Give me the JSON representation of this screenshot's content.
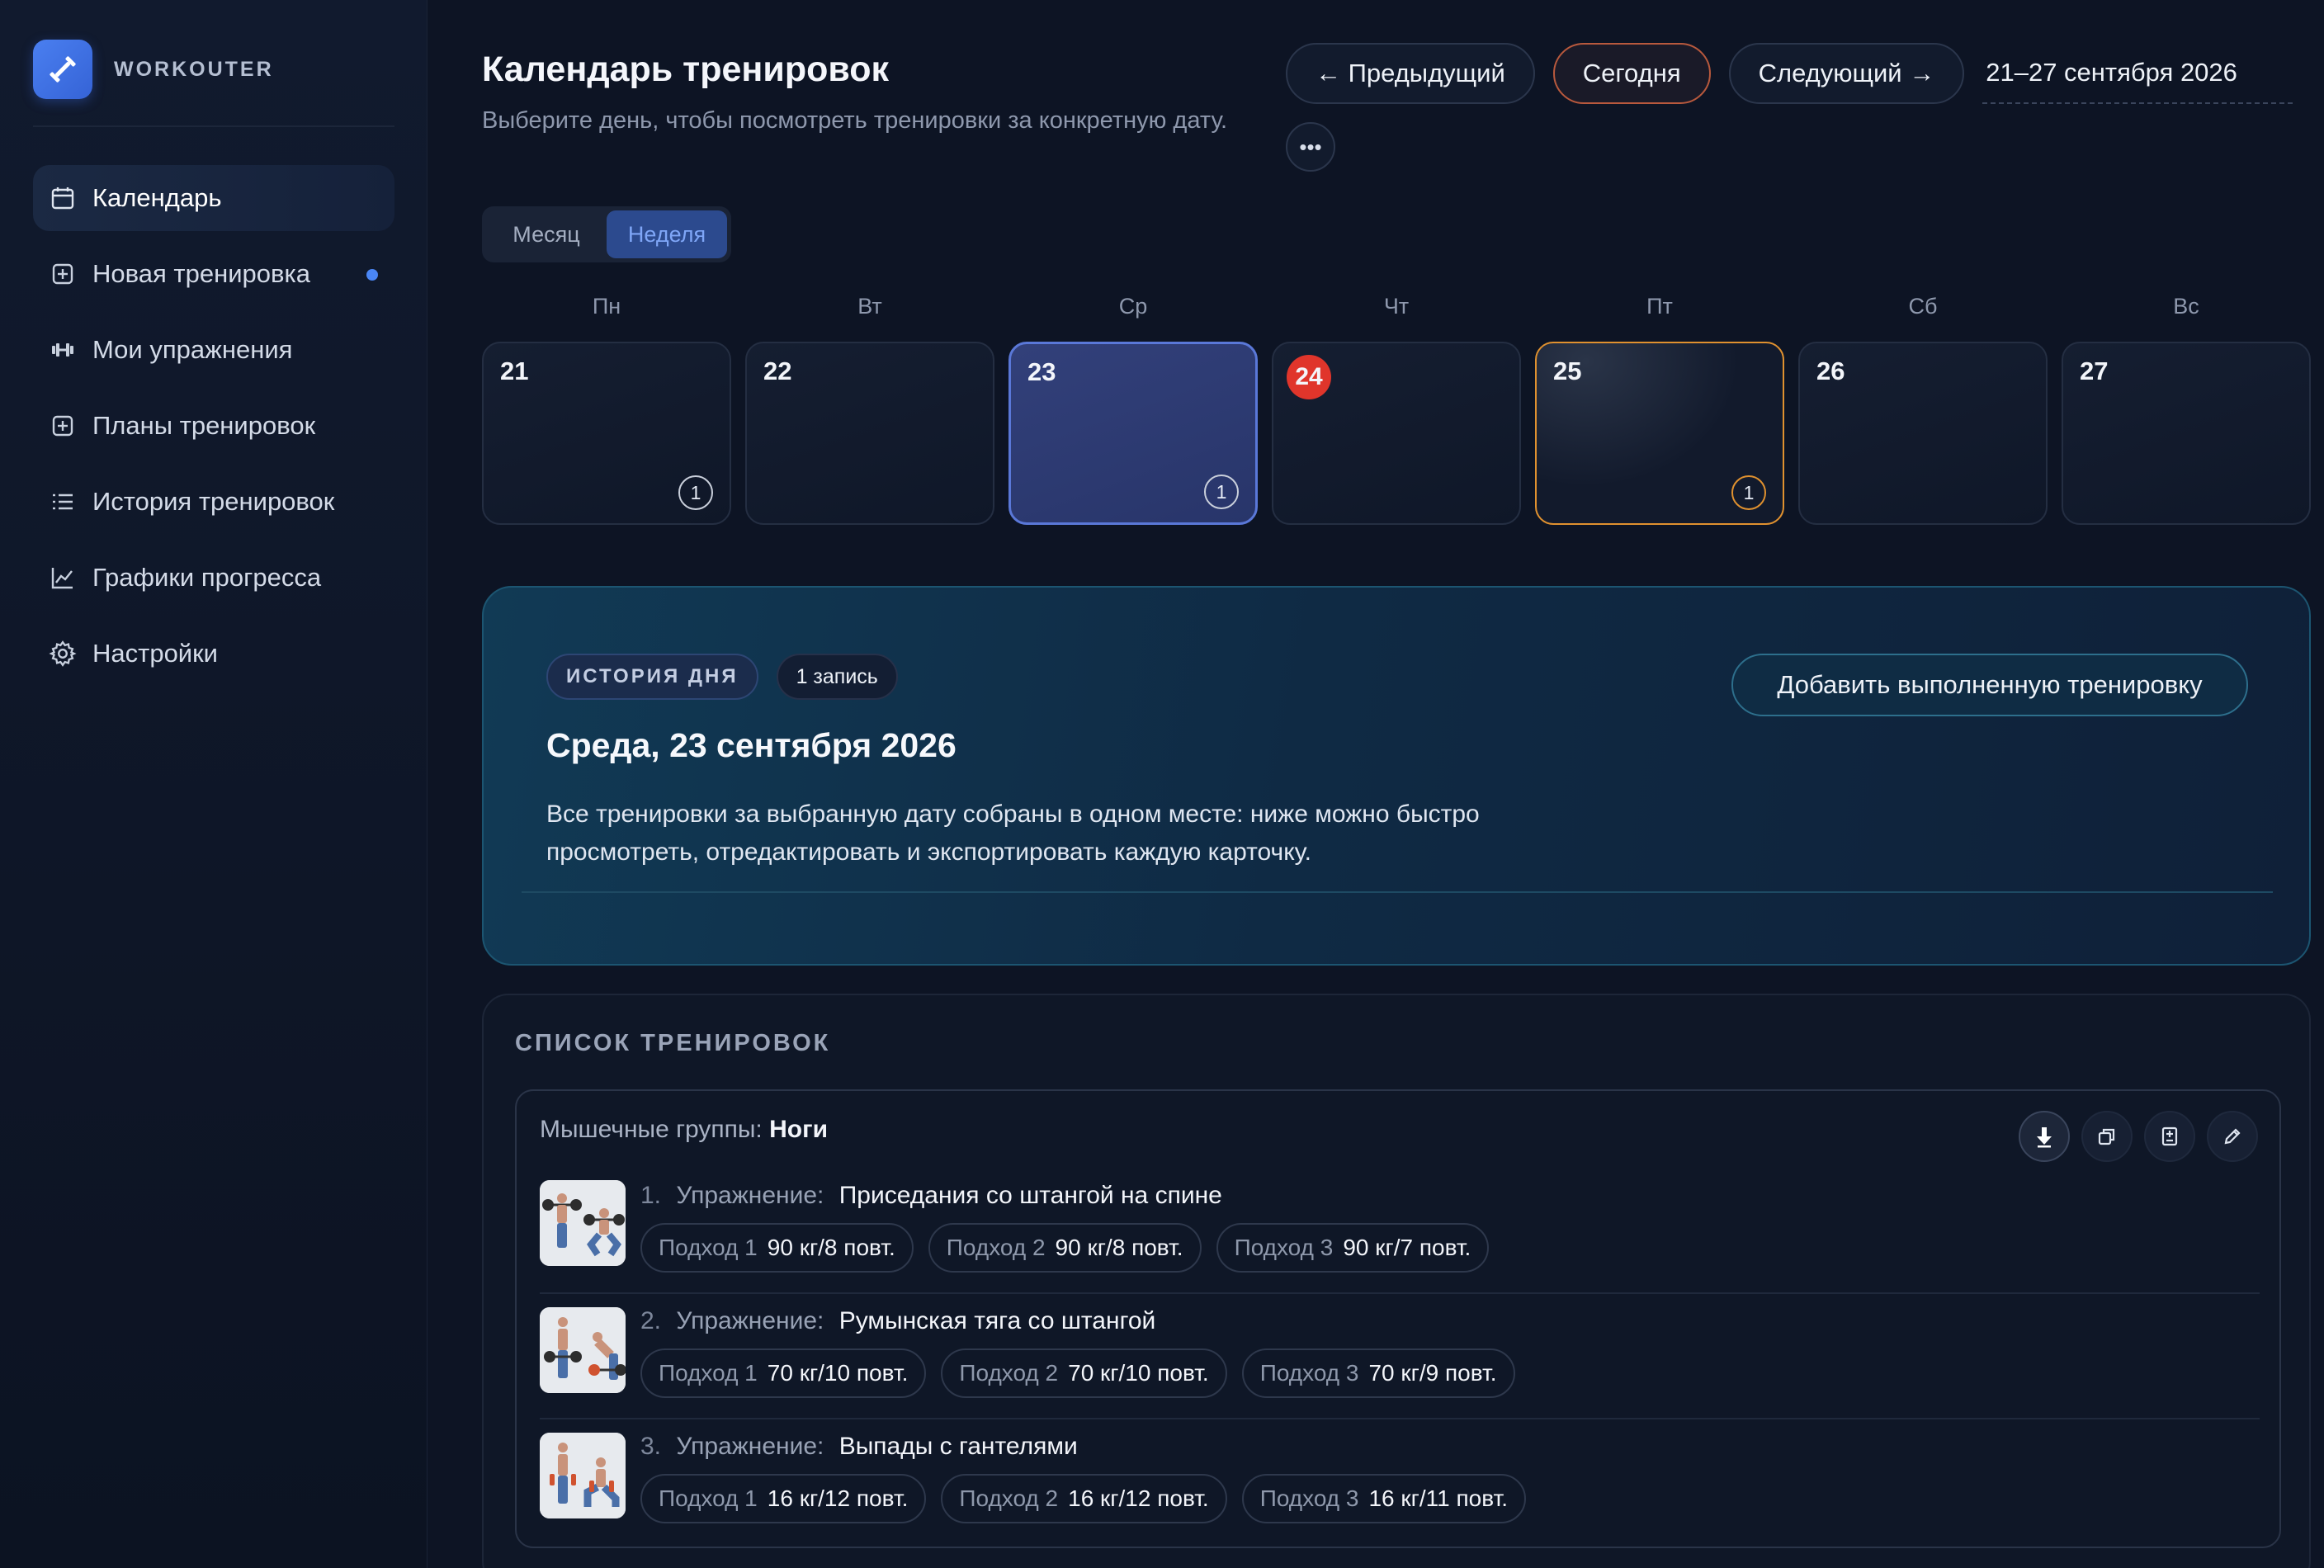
{
  "app": {
    "name": "WORKOUTER"
  },
  "sidebar": {
    "items": [
      {
        "label": "Календарь",
        "icon": "calendar-icon",
        "active": true
      },
      {
        "label": "Новая тренировка",
        "icon": "plus-square-icon",
        "dot": true
      },
      {
        "label": "Мои упражнения",
        "icon": "dumbbell-icon"
      },
      {
        "label": "Планы тренировок",
        "icon": "plus-square-icon"
      },
      {
        "label": "История тренировок",
        "icon": "list-icon"
      },
      {
        "label": "Графики прогресса",
        "icon": "chart-line-icon"
      },
      {
        "label": "Настройки",
        "icon": "gear-icon"
      }
    ]
  },
  "header": {
    "title": "Календарь тренировок",
    "subtitle": "Выберите день, чтобы посмотреть тренировки за конкретную дату.",
    "prev_label": "← Предыдущий",
    "today_label": "Сегодня",
    "next_label": "Следующий →",
    "date_range": "21–27 сентября 2026",
    "more_label": "•••"
  },
  "view_toggle": {
    "month": "Месяц",
    "week": "Неделя",
    "selected": "week"
  },
  "week": {
    "weekdays": [
      "Пн",
      "Вт",
      "Ср",
      "Чт",
      "Пт",
      "Сб",
      "Вс"
    ],
    "days": [
      {
        "num": "21",
        "count": "1"
      },
      {
        "num": "22",
        "count": ""
      },
      {
        "num": "23",
        "count": "1",
        "selected": true
      },
      {
        "num": "24",
        "count": "",
        "today": true
      },
      {
        "num": "25",
        "count": "1",
        "highlight": true
      },
      {
        "num": "26",
        "count": ""
      },
      {
        "num": "27",
        "count": ""
      }
    ]
  },
  "day_panel": {
    "tag": "ИСТОРИЯ ДНЯ",
    "count": "1 запись",
    "title": "Среда, 23 сентября 2026",
    "description": "Все тренировки за выбранную дату собраны в одном месте: ниже можно быстро просмотреть, отредактировать и экспортировать каждую карточку.",
    "add_button": "Добавить выполненную тренировку"
  },
  "workouts": {
    "title": "СПИСОК ТРЕНИРОВОК",
    "card": {
      "muscle_label": "Мышечные группы:",
      "muscle_value": "Ноги",
      "exercise_label": "Упражнение:",
      "exercises": [
        {
          "idx": "1.",
          "name": "Приседания со штангой на спине",
          "sets": [
            {
              "label": "Подход 1",
              "value": "90 кг/8 повт."
            },
            {
              "label": "Подход 2",
              "value": "90 кг/8 повт."
            },
            {
              "label": "Подход 3",
              "value": "90 кг/7 повт."
            }
          ]
        },
        {
          "idx": "2.",
          "name": "Румынская тяга со штангой",
          "sets": [
            {
              "label": "Подход 1",
              "value": "70 кг/10 повт."
            },
            {
              "label": "Подход 2",
              "value": "70 кг/10 повт."
            },
            {
              "label": "Подход 3",
              "value": "70 кг/9 повт."
            }
          ]
        },
        {
          "idx": "3.",
          "name": "Выпады с гантелями",
          "sets": [
            {
              "label": "Подход 1",
              "value": "16 кг/12 повт."
            },
            {
              "label": "Подход 2",
              "value": "16 кг/12 повт."
            },
            {
              "label": "Подход 3",
              "value": "16 кг/11 повт."
            }
          ]
        }
      ]
    }
  },
  "colors": {
    "accent": "#4a7ff0",
    "today_red": "#e0352b",
    "highlight_orange": "#e0912f",
    "selected_blue": "#5a78d8"
  }
}
